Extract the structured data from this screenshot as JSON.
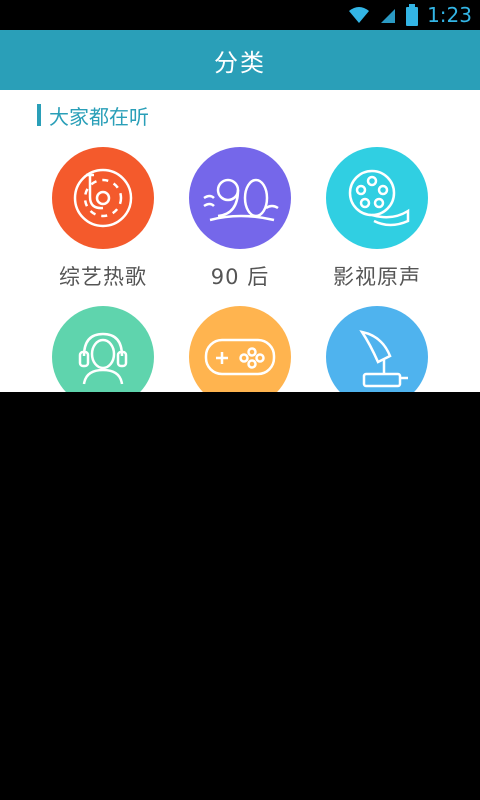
{
  "status_bar": {
    "time": "1:23",
    "icons": [
      "wifi-icon",
      "signal-icon",
      "battery-icon"
    ],
    "accent_color": "#33b5e5"
  },
  "app_bar": {
    "title": "分类",
    "color": "#2a9fb8"
  },
  "section": {
    "title": "大家都在听"
  },
  "categories": [
    {
      "label": "综艺热歌",
      "icon": "turntable-icon",
      "color": "#f45a2c"
    },
    {
      "label": "90 后",
      "icon": "ninety-icon",
      "color": "#7567ea"
    },
    {
      "label": "影视原声",
      "icon": "film-reel-icon",
      "color": "#30cfe2"
    },
    {
      "label": "",
      "icon": "headphones-person-icon",
      "color": "#5fd4ad"
    },
    {
      "label": "",
      "icon": "gamepad-icon",
      "color": "#ffb44f"
    },
    {
      "label": "",
      "icon": "gramophone-icon",
      "color": "#4fb3ee"
    }
  ]
}
